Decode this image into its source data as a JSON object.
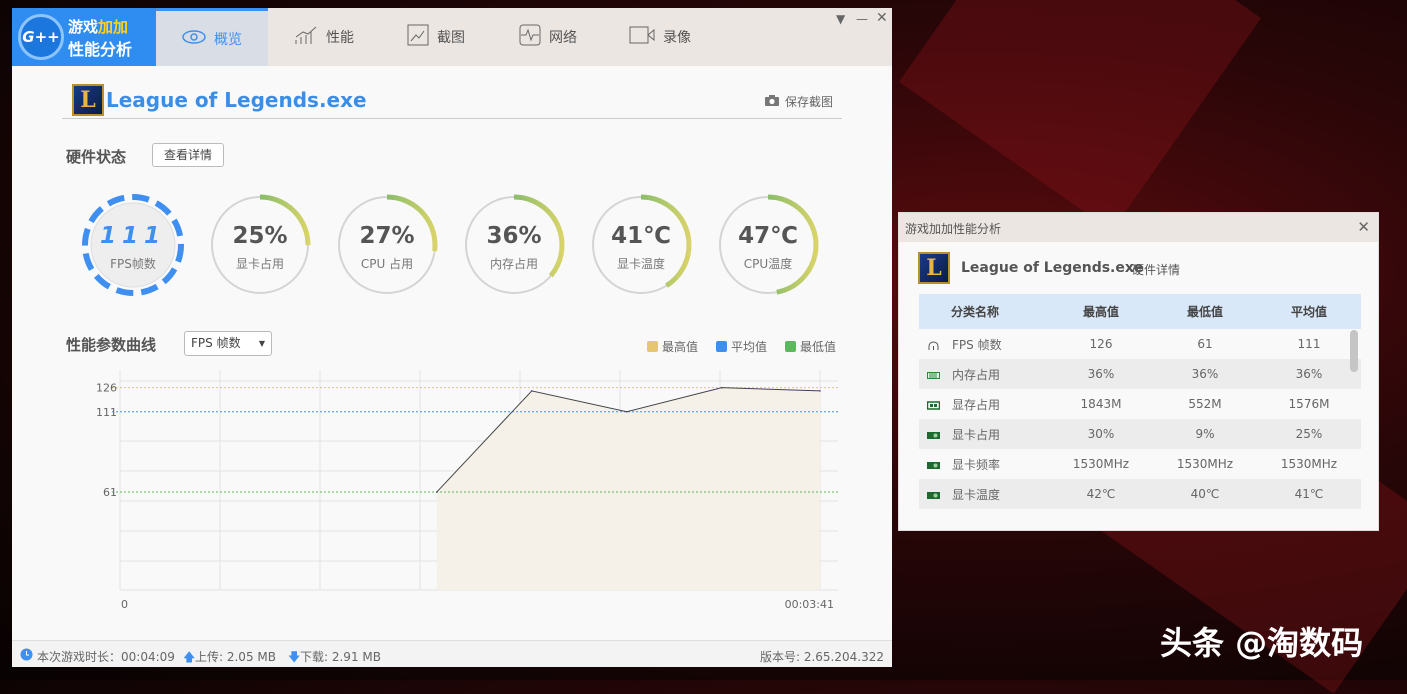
{
  "app": {
    "logo_badge": "G++",
    "logo_line1a": "游戏",
    "logo_line1b": "加加",
    "logo_line2": "性能分析"
  },
  "tabs": [
    {
      "label": "概览",
      "icon": "eye-icon",
      "active": true
    },
    {
      "label": "性能",
      "icon": "bar-chart-icon"
    },
    {
      "label": "截图",
      "icon": "image-icon"
    },
    {
      "label": "网络",
      "icon": "pulse-icon"
    },
    {
      "label": "录像",
      "icon": "video-icon"
    }
  ],
  "header": {
    "game": "League of Legends.exe",
    "save_label": "保存截图"
  },
  "hardware": {
    "title": "硬件状态",
    "details_button": "查看详情",
    "gauges": [
      {
        "value": "111",
        "label": "FPS帧数"
      },
      {
        "value": "25%",
        "label": "显卡占用",
        "fraction": 0.25
      },
      {
        "value": "27%",
        "label": "CPU 占用",
        "fraction": 0.27
      },
      {
        "value": "36%",
        "label": "内存占用",
        "fraction": 0.36
      },
      {
        "value": "41℃",
        "label": "显卡温度",
        "fraction": 0.41
      },
      {
        "value": "47℃",
        "label": "CPU温度",
        "fraction": 0.47
      }
    ]
  },
  "curve": {
    "title": "性能参数曲线",
    "select": "FPS 帧数",
    "legend": [
      {
        "label": "最高值",
        "color": "#e6c66e"
      },
      {
        "label": "平均值",
        "color": "#3f8ff0"
      },
      {
        "label": "最低值",
        "color": "#5cb85c"
      }
    ]
  },
  "chart_data": {
    "type": "area",
    "series": [
      {
        "name": "FPS 帧数",
        "x": [
          100,
          130,
          160,
          190,
          221
        ],
        "y": [
          61,
          124,
          111,
          126,
          124
        ]
      }
    ],
    "ref_lines": {
      "max": 126,
      "avg": 111,
      "min": 61
    },
    "ytick_labels": [
      "126",
      "111",
      "61"
    ],
    "xtick_labels": [
      "0",
      "00:03:41"
    ],
    "xlim": [
      0,
      221
    ],
    "ylim": [
      0,
      137
    ]
  },
  "status": {
    "duration": "本次游戏时长：00:04:09",
    "upload": "上传: 2.05 MB",
    "download": "下载: 2.91 MB",
    "version": "版本号: 2.65.204.322"
  },
  "side": {
    "title": "游戏加加性能分析",
    "game": "League of Legends.exe",
    "subtitle": "硬件详情",
    "columns": [
      "分类名称",
      "最高值",
      "最低值",
      "平均值"
    ],
    "rows": [
      [
        "FPS 帧数",
        "126",
        "61",
        "111"
      ],
      [
        "内存占用",
        "36%",
        "36%",
        "36%"
      ],
      [
        "显存占用",
        "1843M",
        "552M",
        "1576M"
      ],
      [
        "显卡占用",
        "30%",
        "9%",
        "25%"
      ],
      [
        "显卡频率",
        "1530MHz",
        "1530MHz",
        "1530MHz"
      ],
      [
        "显卡温度",
        "42℃",
        "40℃",
        "41℃"
      ]
    ]
  },
  "watermark": "头条 @淘数码"
}
